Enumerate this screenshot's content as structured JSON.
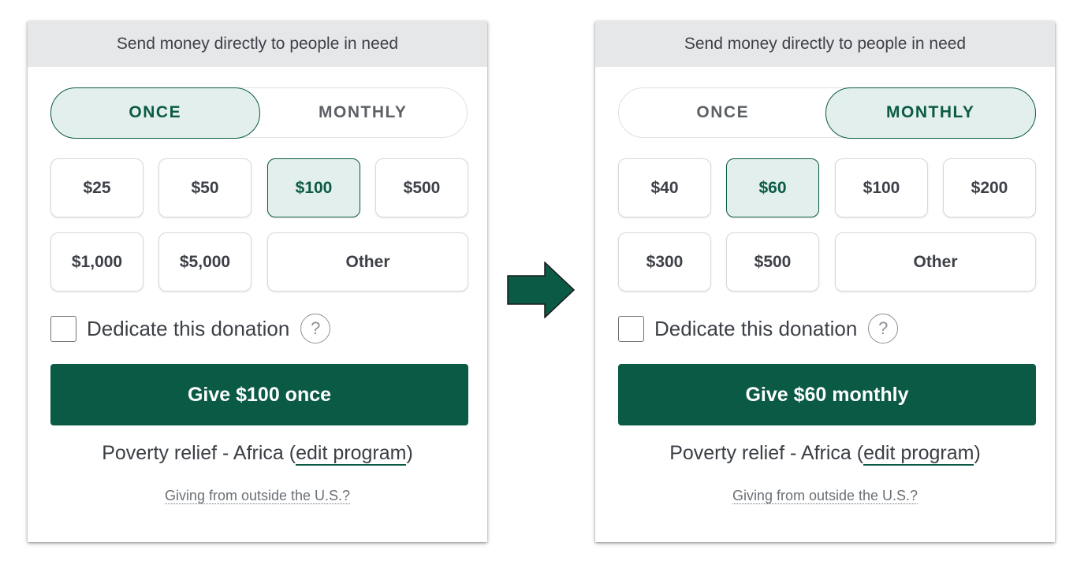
{
  "colors": {
    "brand_green": "#0b5a46",
    "selected_fill": "#e3efec",
    "header_bg": "#e6e7e9"
  },
  "arrow_icon": "right-arrow-icon",
  "left": {
    "header": "Send money directly to people in need",
    "frequency": {
      "once": "ONCE",
      "monthly": "MONTHLY",
      "selected": "ONCE"
    },
    "amounts": [
      "$25",
      "$50",
      "$100",
      "$500",
      "$1,000",
      "$5,000",
      "Other"
    ],
    "selected_amount": "$100",
    "dedicate_label": "Dedicate this donation",
    "help_icon": "?",
    "give_button": "Give $100 once",
    "program": {
      "prefix": "Poverty relief - Africa (",
      "link": "edit program",
      "suffix": ")"
    },
    "outside_link": "Giving from outside the U.S.?"
  },
  "right": {
    "header": "Send money directly to people in need",
    "frequency": {
      "once": "ONCE",
      "monthly": "MONTHLY",
      "selected": "MONTHLY"
    },
    "amounts": [
      "$40",
      "$60",
      "$100",
      "$200",
      "$300",
      "$500",
      "Other"
    ],
    "selected_amount": "$60",
    "dedicate_label": "Dedicate this donation",
    "help_icon": "?",
    "give_button": "Give $60 monthly",
    "program": {
      "prefix": "Poverty relief - Africa (",
      "link": "edit program",
      "suffix": ")"
    },
    "outside_link": "Giving from outside the U.S.?"
  }
}
